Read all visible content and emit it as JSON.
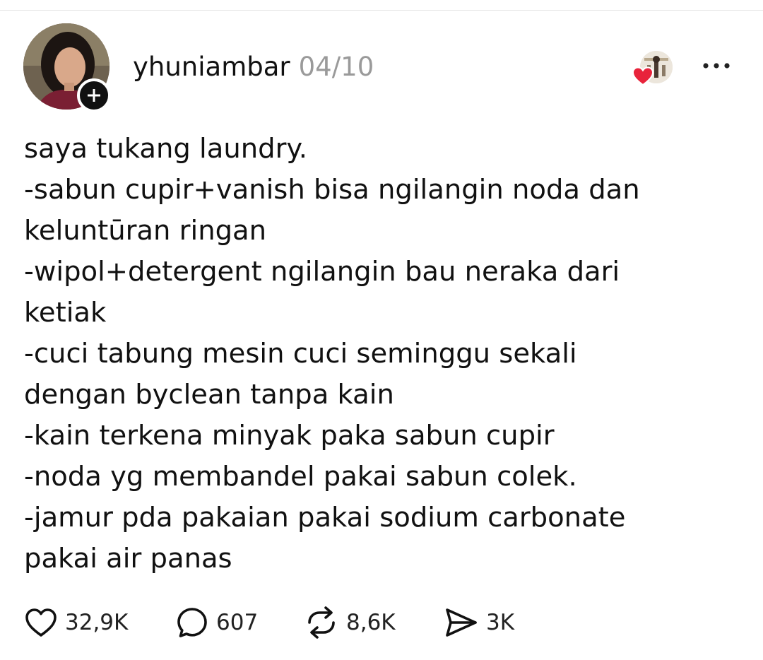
{
  "post": {
    "username": "yhuniambar",
    "date": "04/10",
    "body_lines": [
      "saya tukang laundry.",
      "-sabun cupir+vanish bisa ngilangin noda dan",
      "keluntūran ringan",
      "-wipol+detergent ngilangin bau neraka dari",
      "ketiak",
      "-cuci tabung mesin cuci seminggu sekali",
      "dengan byclean tanpa kain",
      "-kain terkena minyak paka sabun cupir",
      "-noda yg membandel pakai sabun colek.",
      "-jamur pda pakaian pakai sodium carbonate",
      "pakai air panas"
    ]
  },
  "actions": {
    "like_count": "32,9K",
    "reply_count": "607",
    "repost_count": "8,6K",
    "share_count": "3K"
  },
  "icons": {
    "follow": "plus-icon",
    "liker": "liked-by-avatar",
    "more": "more-options-icon",
    "like": "heart-icon",
    "reply": "comment-bubble-icon",
    "repost": "repost-icon",
    "share": "send-icon"
  },
  "colors": {
    "text": "#111111",
    "muted": "#9a9a9a",
    "heart_red": "#e8233b",
    "badge": "#111111"
  }
}
